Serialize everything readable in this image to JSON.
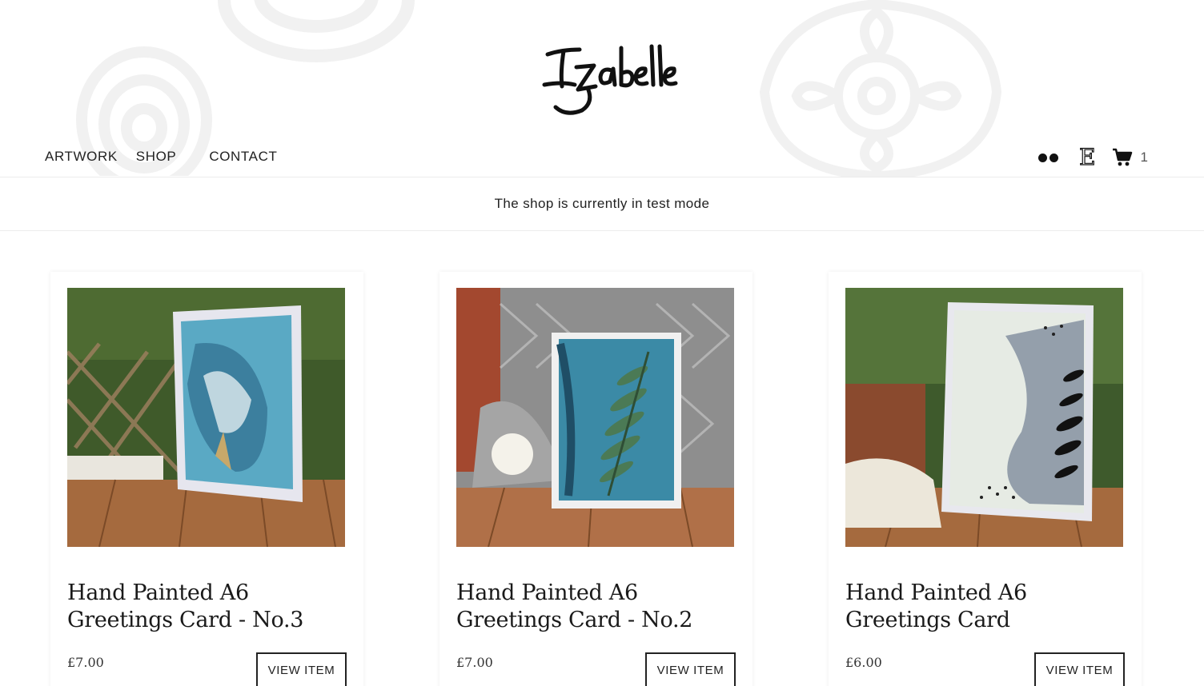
{
  "site": {
    "logo_text": "Izabelle"
  },
  "nav": {
    "items": [
      {
        "label": "ARTWORK"
      },
      {
        "label": "SHOP"
      },
      {
        "label": "CONTACT"
      }
    ]
  },
  "header_icons": {
    "flickr": "flickr-icon",
    "etsy": "E",
    "cart": "cart-icon",
    "cart_count": "1"
  },
  "notice": {
    "text": "The shop is currently in test mode"
  },
  "products": [
    {
      "title": "Hand Painted A6 Greetings Card - No.3",
      "price": "£7.00",
      "button": "VIEW ITEM"
    },
    {
      "title": "Hand Painted A6 Greetings Card - No.2",
      "price": "£7.00",
      "button": "VIEW ITEM"
    },
    {
      "title": "Hand Painted A6 Greetings Card",
      "price": "£6.00",
      "button": "VIEW ITEM"
    }
  ],
  "colors": {
    "text": "#222222",
    "border": "#ececec",
    "deco": "#f3f3f3"
  }
}
